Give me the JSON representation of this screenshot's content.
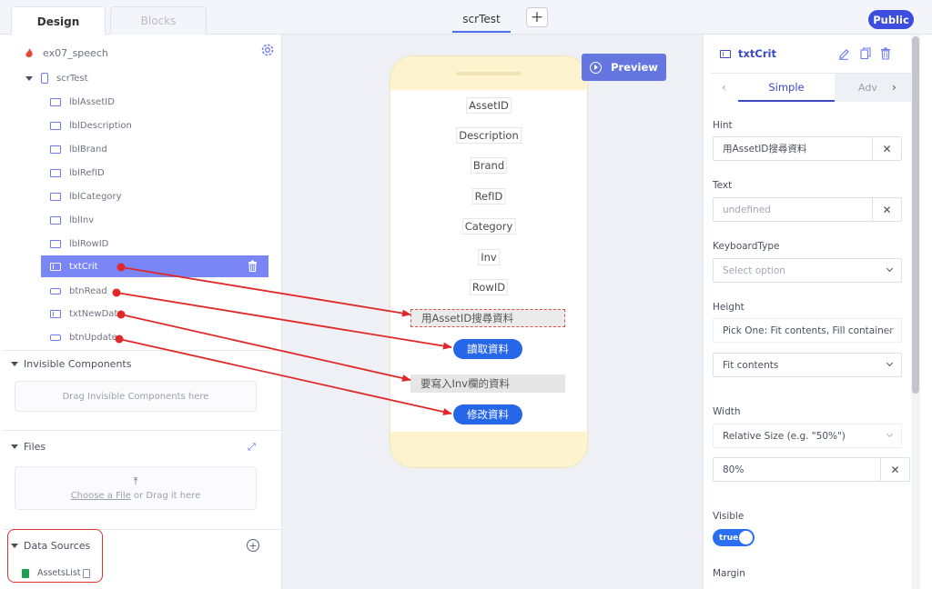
{
  "topbar": {
    "tabs": [
      "Design",
      "Blocks"
    ],
    "screen_tab": "scrTest",
    "add_screen": "+",
    "public_label": "Public"
  },
  "tree": {
    "project": "ex07_speech",
    "screen": "scrTest",
    "components": [
      {
        "name": "lblAssetID",
        "kind": "label"
      },
      {
        "name": "lblDescription",
        "kind": "label"
      },
      {
        "name": "lblBrand",
        "kind": "label"
      },
      {
        "name": "lblRefID",
        "kind": "label"
      },
      {
        "name": "lblCategory",
        "kind": "label"
      },
      {
        "name": "lblInv",
        "kind": "label"
      },
      {
        "name": "lblRowID",
        "kind": "label"
      },
      {
        "name": "txtCrit",
        "kind": "input"
      },
      {
        "name": "btnRead",
        "kind": "button"
      },
      {
        "name": "txtNewData",
        "kind": "input"
      },
      {
        "name": "btnUpdate",
        "kind": "button"
      }
    ],
    "selected": "txtCrit"
  },
  "sections": {
    "invisible": {
      "title": "Invisible Components",
      "drop_text": "Drag Invisible Components here"
    },
    "files": {
      "title": "Files",
      "choose_link": "Choose a File",
      "or_drag": " or Drag it here"
    },
    "data_sources": {
      "title": "Data Sources",
      "items": [
        "AssetsList"
      ]
    }
  },
  "canvas": {
    "preview_label": "Preview",
    "labels": [
      "AssetID",
      "Description",
      "Brand",
      "RefID",
      "Category",
      "Inv",
      "RowID"
    ],
    "txtCrit_hint": "用AssetID搜尋資料",
    "btnRead_text": "讀取資料",
    "txtNewData_hint": "要寫入Inv欄的資料",
    "btnUpdate_text": "修改資料"
  },
  "props": {
    "component": "txtCrit",
    "tabs": {
      "simple": "Simple",
      "advanced": "Adv"
    },
    "hint": {
      "label": "Hint",
      "value": "用AssetID搜尋資料"
    },
    "text": {
      "label": "Text",
      "placeholder": "undefined"
    },
    "keyboard": {
      "label": "KeyboardType",
      "placeholder": "Select option"
    },
    "height": {
      "label": "Height",
      "mode": "Pick One: Fit contents, Fill container",
      "value": "Fit contents"
    },
    "width": {
      "label": "Width",
      "mode": "Relative Size (e.g. \"50%\")",
      "value": "80%"
    },
    "visible": {
      "label": "Visible",
      "value": "true"
    },
    "margin": {
      "label": "Margin"
    }
  },
  "colors": {
    "accent": "#3d4de0",
    "selected_row": "#7b86f6",
    "button": "#2666e8",
    "annotation": "#e02828"
  }
}
